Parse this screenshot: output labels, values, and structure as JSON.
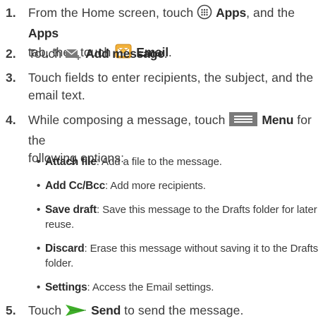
{
  "steps": [
    {
      "num": "1.",
      "parts": {
        "t1": "From the Home screen, touch ",
        "apps_label": "Apps",
        "t2": ", and the ",
        "apps_tab": "Apps",
        "t3": " tab, then touch ",
        "email_label": "Email",
        "t4": "."
      },
      "icons": [
        "apps-icon",
        "email-app-icon"
      ]
    },
    {
      "num": "2.",
      "parts": {
        "t1": "Touch ",
        "add_label": "Add message",
        "t2": "."
      },
      "icons": [
        "add-message-icon"
      ]
    },
    {
      "num": "3.",
      "text_line1": "Touch fields to enter recipients, the subject, and the",
      "text_line2": "email text."
    },
    {
      "num": "4.",
      "parts": {
        "t1": "While composing a message, touch ",
        "menu_label": "Menu",
        "t2": " for the",
        "line2": "following options:"
      },
      "icons": [
        "menu-key-icon"
      ]
    },
    {
      "num": "5.",
      "parts": {
        "t1": "Touch ",
        "send_label": "Send",
        "t2": " to send the message."
      },
      "icons": [
        "send-icon"
      ]
    }
  ],
  "options": [
    {
      "term": "Attach file",
      "desc": ": Add a file to the message."
    },
    {
      "term": "Add Cc/Bcc",
      "desc": ": Add more recipients."
    },
    {
      "term": "Save draft",
      "desc": ": Save this message to the Drafts folder for later",
      "desc2": "reuse."
    },
    {
      "term": "Discard",
      "desc": ": Erase this message without saving it to the Drafts",
      "desc2": "folder."
    },
    {
      "term": "Settings",
      "desc": ": Access the Email settings."
    }
  ],
  "colors": {
    "text": "#3c3c3c",
    "icon_gray": "#7a7a7a",
    "email_orange": "#f0a323",
    "send_green": "#3fae2a"
  }
}
